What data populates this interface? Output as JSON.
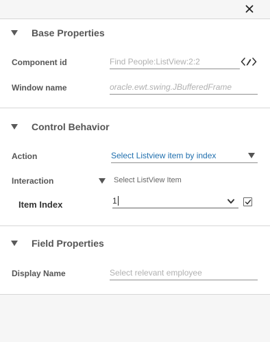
{
  "icons": {
    "close": "close-icon",
    "edit_selector": "code-edit-icon",
    "collapse": "triangle-down-icon",
    "chevron": "chevron-down-icon",
    "checkbox": "checkbox-checked-icon"
  },
  "sections": {
    "base": {
      "title": "Base Properties",
      "component_id_label": "Component id",
      "component_id_value": "Find People:ListView:2:2",
      "window_name_label": "Window name",
      "window_name_value": "oracle.ewt.swing.JBufferedFrame"
    },
    "control": {
      "title": "Control Behavior",
      "action_label": "Action",
      "action_value": "Select Listview item by index",
      "interaction_label": "Interaction",
      "interaction_value": "Select ListView Item",
      "item_index_label": "Item Index",
      "item_index_value": "1",
      "item_index_checked": true
    },
    "field": {
      "title": "Field Properties",
      "display_name_label": "Display Name",
      "display_name_placeholder": "Select relevant employee"
    }
  },
  "colors": {
    "accent_text": "#1f6fae",
    "section_bg": "#ffffff",
    "page_bg": "#f6f6f6"
  }
}
